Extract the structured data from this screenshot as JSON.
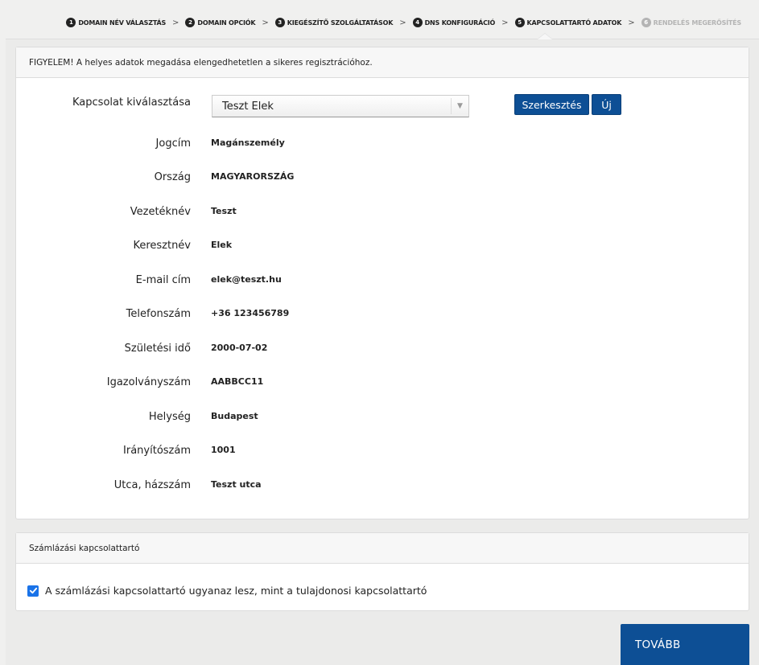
{
  "steps": [
    {
      "num": "1",
      "label": "DOMAIN NÉV VÁLASZTÁS"
    },
    {
      "num": "2",
      "label": "DOMAIN OPCIÓK"
    },
    {
      "num": "3",
      "label": "KIEGÉSZÍTŐ SZOLGÁLTATÁSOK"
    },
    {
      "num": "4",
      "label": "DNS KONFIGURÁCIÓ"
    },
    {
      "num": "5",
      "label": "KAPCSOLATTARTÓ ADATOK"
    },
    {
      "num": "6",
      "label": "RENDELÉS MEGERŐSÍTÉS"
    }
  ],
  "step_separator": ">",
  "warning": "FIGYELEM! A helyes adatok megadása elengedhetetlen a sikeres regisztrációhoz.",
  "contact_select": {
    "label": "Kapcsolat kiválasztása",
    "value": "Teszt Elek",
    "arrow": "▼",
    "edit_label": "Szerkesztés",
    "new_label": "Új"
  },
  "fields": [
    {
      "label": "Jogcím",
      "value": "Magánszemély"
    },
    {
      "label": "Ország",
      "value": "MAGYARORSZÁG"
    },
    {
      "label": "Vezetéknév",
      "value": "Teszt"
    },
    {
      "label": "Keresztnév",
      "value": "Elek"
    },
    {
      "label": "E-mail cím",
      "value": "elek@teszt.hu"
    },
    {
      "label": "Telefonszám",
      "value": "+36 123456789"
    },
    {
      "label": "Születési idő",
      "value": "2000-07-02"
    },
    {
      "label": "Igazolványszám",
      "value": "AABBCC11"
    },
    {
      "label": "Helység",
      "value": "Budapest"
    },
    {
      "label": "Irányítószám",
      "value": "1001"
    },
    {
      "label": "Utca, házszám",
      "value": "Teszt utca"
    }
  ],
  "billing": {
    "title": "Számlázási kapcsolattartó",
    "checkbox_label": "A számlázási kapcsolattartó ugyanaz lesz, mint a tulajdonosi kapcsolattartó",
    "checked": true
  },
  "next_label": "TOVÁBB",
  "colors": {
    "primary": "#0d4f95",
    "checkbox": "#1a73e8",
    "disabled_step": "#b4b4b4"
  },
  "icons": {
    "checkbox": "checkmark-icon",
    "dropdown": "triangle-down-icon"
  }
}
